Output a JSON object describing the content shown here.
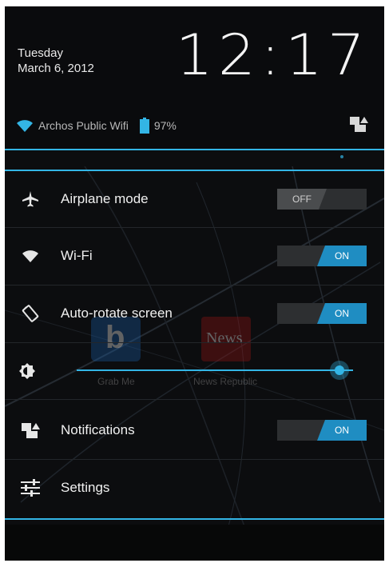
{
  "header": {
    "day": "Tuesday",
    "date": "March 6, 2012",
    "clock": "12:17",
    "wifi_network": "Archos Public Wifi",
    "battery": "97%"
  },
  "background_apps": {
    "app1_letter": "b",
    "app1_label": "Grab Me",
    "app2_label": "News Republic",
    "app2_title": "News"
  },
  "quick_settings": {
    "airplane": {
      "label": "Airplane mode",
      "state": "OFF"
    },
    "wifi": {
      "label": "Wi-Fi",
      "state": "ON"
    },
    "autorotate": {
      "label": "Auto-rotate screen",
      "state": "ON"
    },
    "brightness": {
      "level": 0.95
    },
    "notifications": {
      "label": "Notifications",
      "state": "ON"
    },
    "settings": {
      "label": "Settings"
    }
  },
  "colors": {
    "accent": "#33b5e5",
    "toggle_on": "#1f8dc2",
    "background": "#0c0d0f"
  },
  "icons": {
    "airplane": "airplane-icon",
    "wifi": "wifi-icon",
    "autorotate": "autorotate-icon",
    "brightness": "brightness-icon",
    "notifications": "notifications-icon",
    "settings": "settings-icon"
  }
}
